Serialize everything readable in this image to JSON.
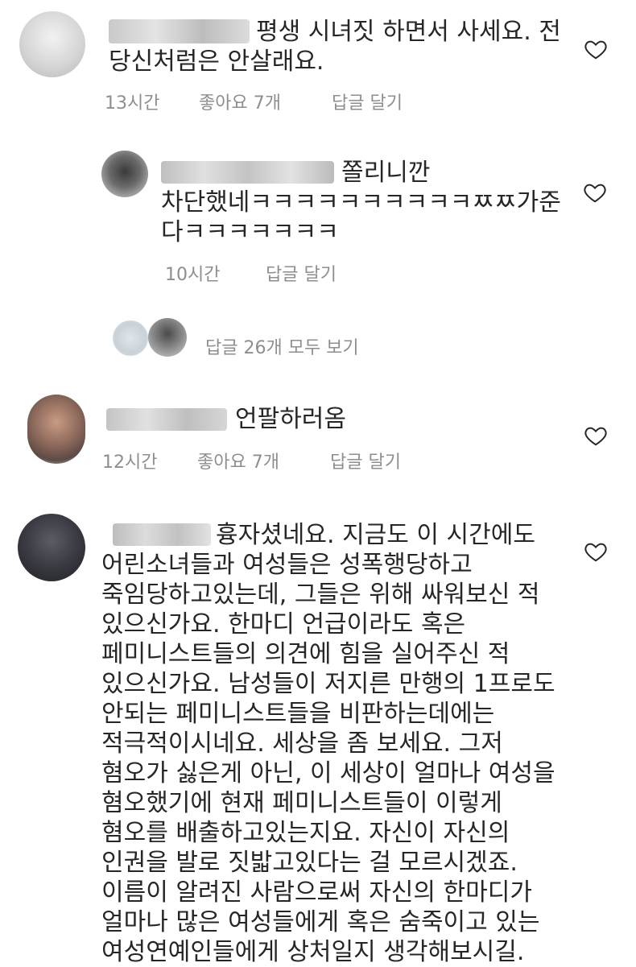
{
  "comments": [
    {
      "lines": [
        "평생 시녀짓 하면서 사세요. 전",
        "당신처럼은 안살래요."
      ],
      "time": "13시간",
      "likes": "좋아요 7개",
      "reply": "답글 달기"
    },
    {
      "lines": [
        "쫄리니깐",
        "차단했네ㅋㅋㅋㅋㅋㅋㅋㅋㅋㅋㅉㅉ가준",
        "다ㅋㅋㅋㅋㅋㅋㅋ"
      ],
      "time": "10시간",
      "reply": "답글 달기"
    },
    {
      "view_replies": "답글 26개 모두 보기"
    },
    {
      "lines": [
        "언팔하러옴"
      ],
      "time": "12시간",
      "likes": "좋아요 7개",
      "reply": "답글 달기"
    },
    {
      "lines": [
        "흉자셨네요. 지금도 이 시간에도",
        "어린소녀들과 여성들은 성폭행당하고",
        "죽임당하고있는데, 그들은 위해 싸워보신 적",
        "있으신가요. 한마디 언급이라도 혹은",
        "페미니스트들의 의견에 힘을 실어주신 적",
        "있으신가요. 남성들이 저지른 만행의 1프로도",
        "안되는 페미니스트들을 비판하는데에는",
        "적극적이시네요. 세상을 좀 보세요. 그저",
        "혐오가 싫은게 아닌, 이 세상이 얼마나 여성을",
        "혐오했기에 현재 페미니스트들이 이렇게",
        "혐오를 배출하고있는지요. 자신이 자신의",
        "인권을 발로 짓밟고있다는 걸 모르시겠죠.",
        "이름이 알려진 사람으로써 자신의 한마디가",
        "얼마나 많은 여성들에게 혹은 숨죽이고 있는",
        "여성연예인들에게 상처일지 생각해보시길."
      ]
    }
  ],
  "icons": {
    "like": "heart-outline-icon"
  },
  "colors": {
    "text": "#262626",
    "meta": "#8e8e8e"
  }
}
